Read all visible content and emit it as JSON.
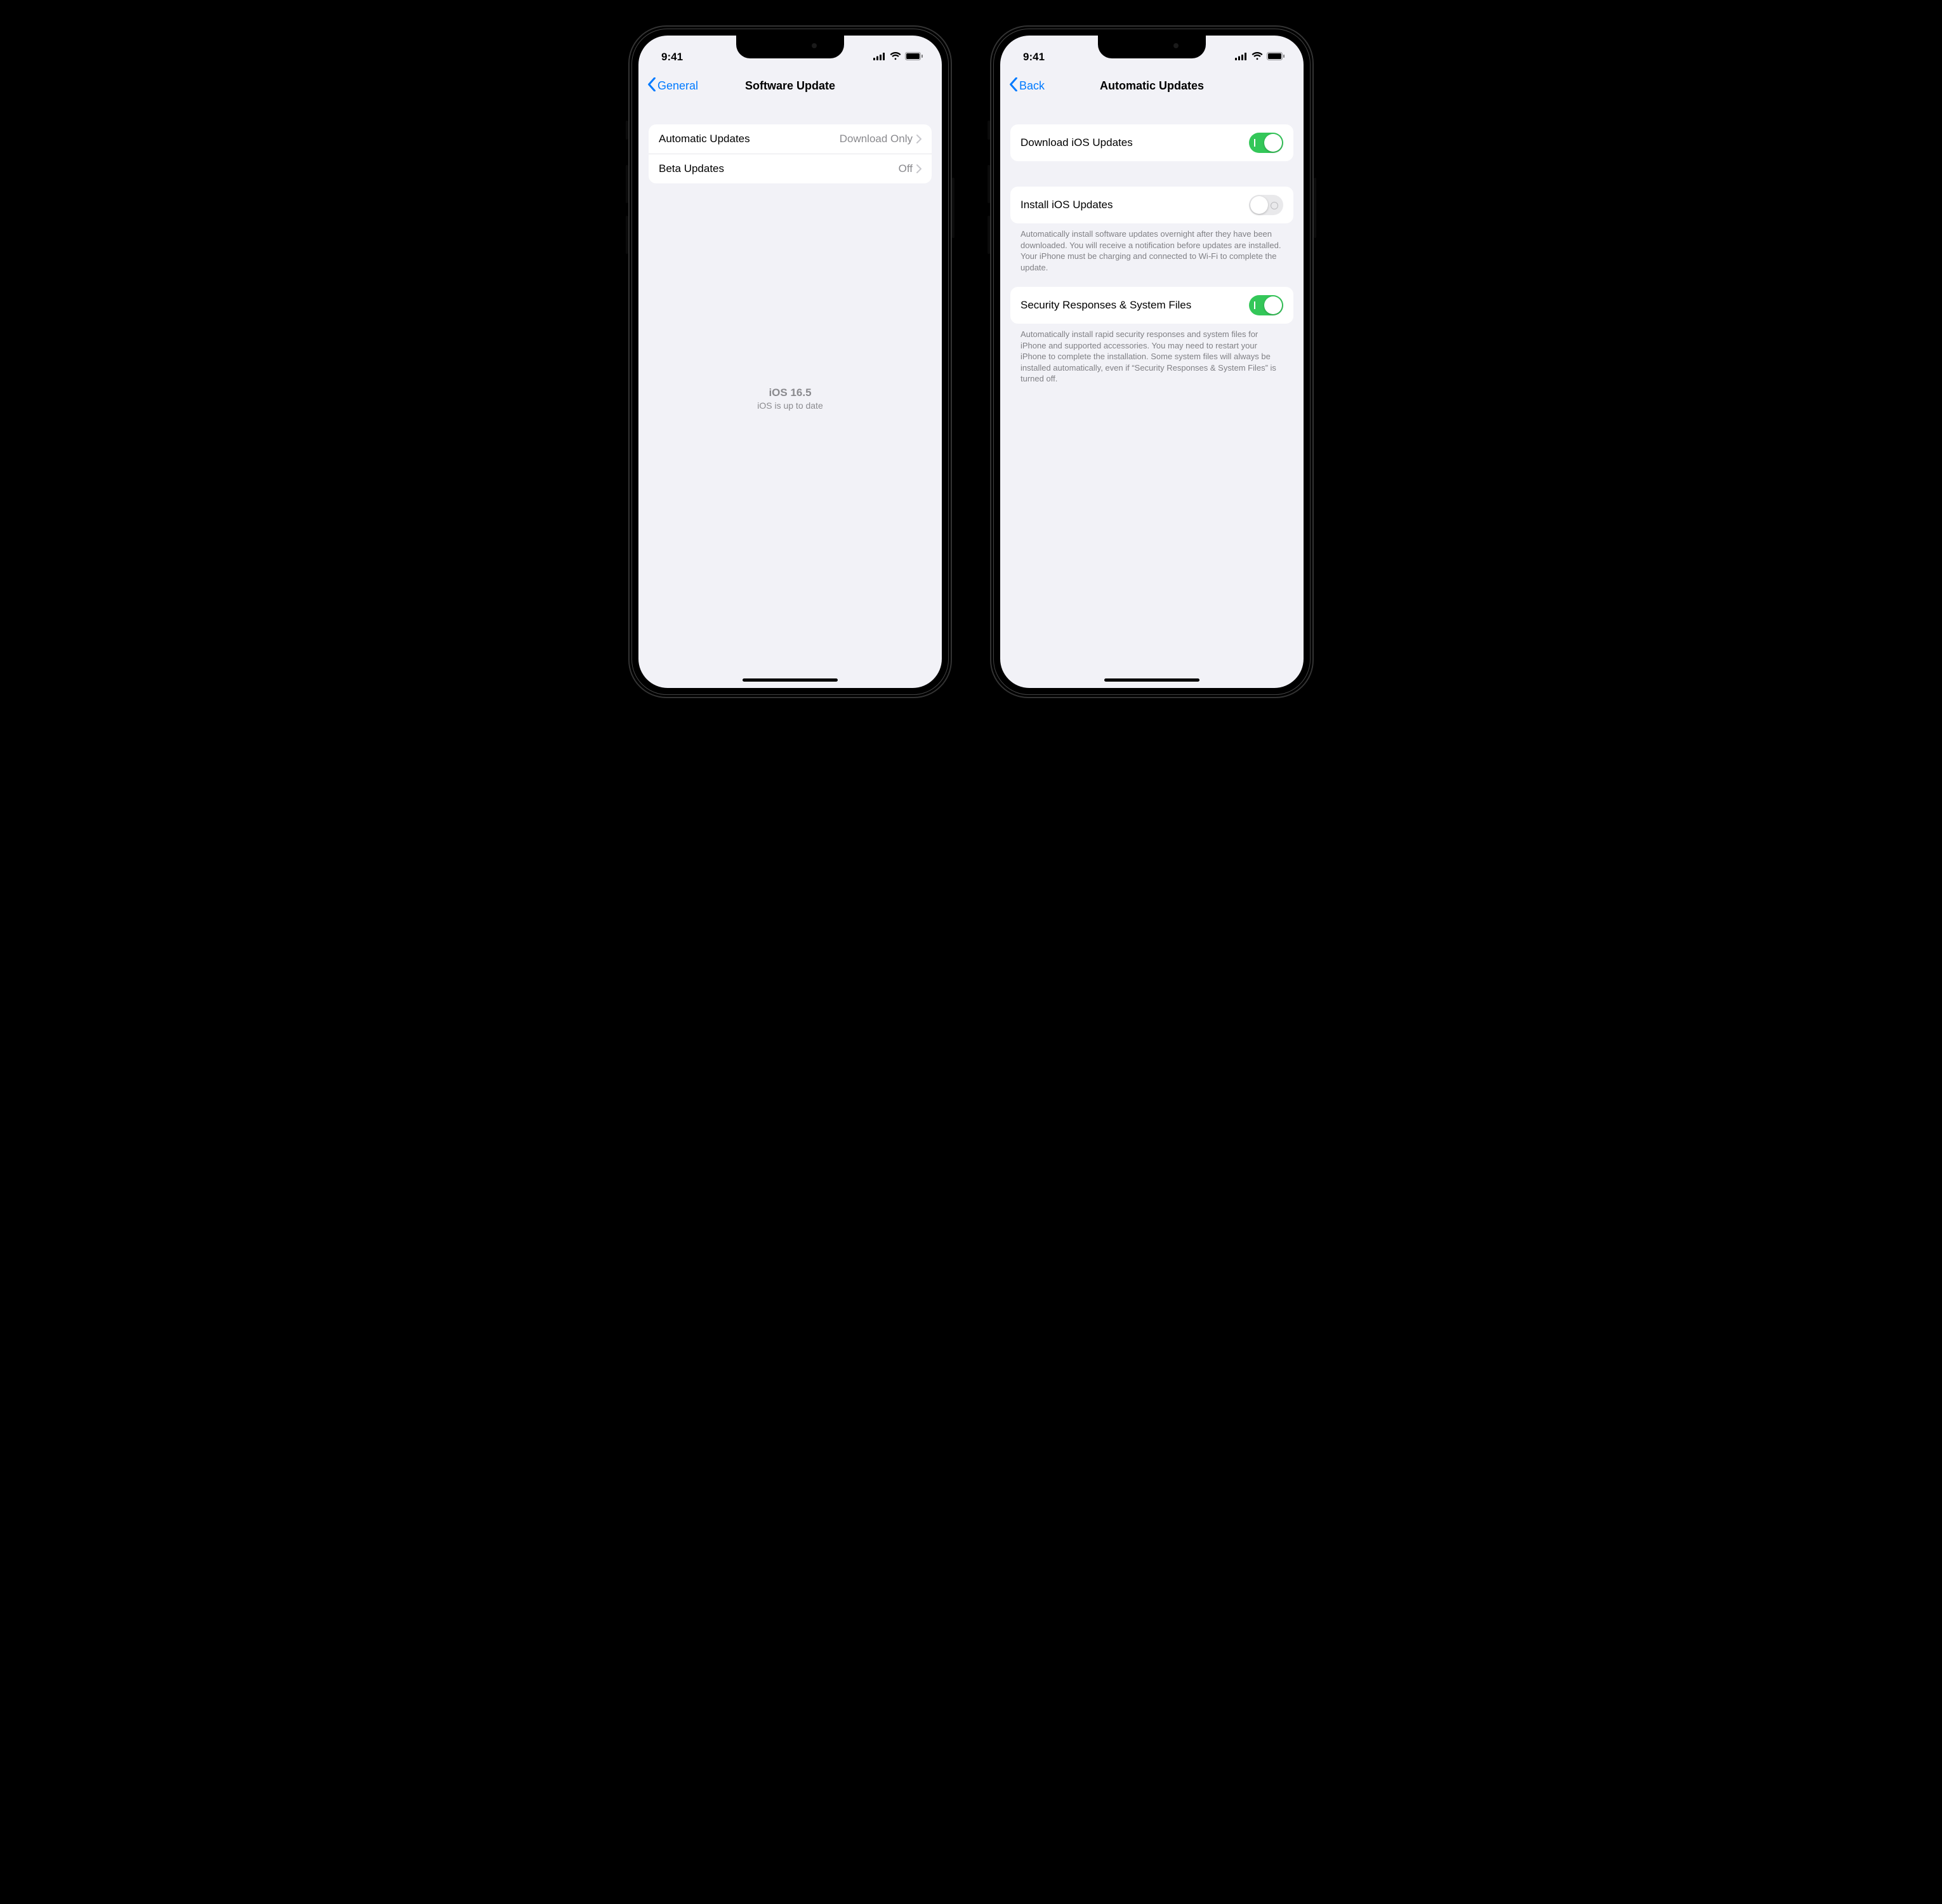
{
  "status": {
    "time": "9:41"
  },
  "phone_left": {
    "back_label": "General",
    "title": "Software Update",
    "rows": [
      {
        "label": "Automatic Updates",
        "value": "Download Only"
      },
      {
        "label": "Beta Updates",
        "value": "Off"
      }
    ],
    "version": "iOS 16.5",
    "status_text": "iOS is up to date"
  },
  "phone_right": {
    "back_label": "Back",
    "title": "Automatic Updates",
    "row_download": {
      "label": "Download iOS Updates",
      "on": true
    },
    "row_install": {
      "label": "Install iOS Updates",
      "on": false
    },
    "install_footer": "Automatically install software updates overnight after they have been downloaded. You will receive a notification before updates are installed. Your iPhone must be charging and connected to Wi-Fi to complete the update.",
    "row_security": {
      "label": "Security Responses & System Files",
      "on": true
    },
    "security_footer": "Automatically install rapid security responses and system files for iPhone and supported accessories. You may need to restart your iPhone to complete the installation. Some system files will always be installed automatically, even if “Security Responses & System Files” is turned off."
  }
}
